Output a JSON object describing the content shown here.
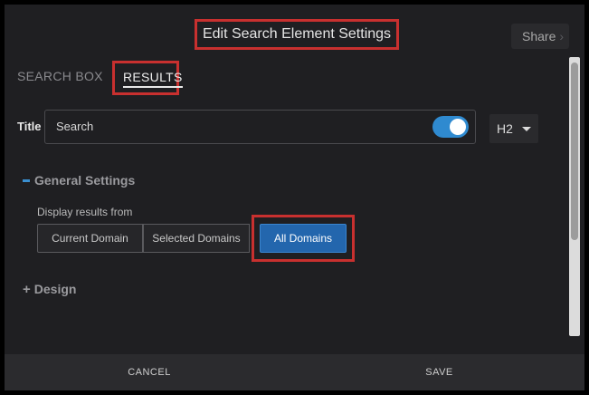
{
  "header": {
    "title": "Edit Search Element Settings",
    "share_label": "Share",
    "share_chevron": "›"
  },
  "tabs": [
    {
      "label": "SEARCH BOX",
      "active": false
    },
    {
      "label": "RESULTS",
      "active": true
    }
  ],
  "title_field": {
    "label": "Title",
    "value": "Search",
    "toggle_on": true,
    "heading_level": "H2"
  },
  "general_settings": {
    "heading": "General Settings",
    "display_results_label": "Display results from",
    "options": [
      "Current Domain",
      "Selected Domains",
      "All Domains"
    ],
    "selected": "All Domains"
  },
  "design": {
    "heading": "Design"
  },
  "footer": {
    "cancel_label": "CANCEL",
    "save_label": "SAVE"
  },
  "colors": {
    "accent": "#2f8ad0",
    "highlight": "#c8302f",
    "selected_button": "#2366ad"
  }
}
